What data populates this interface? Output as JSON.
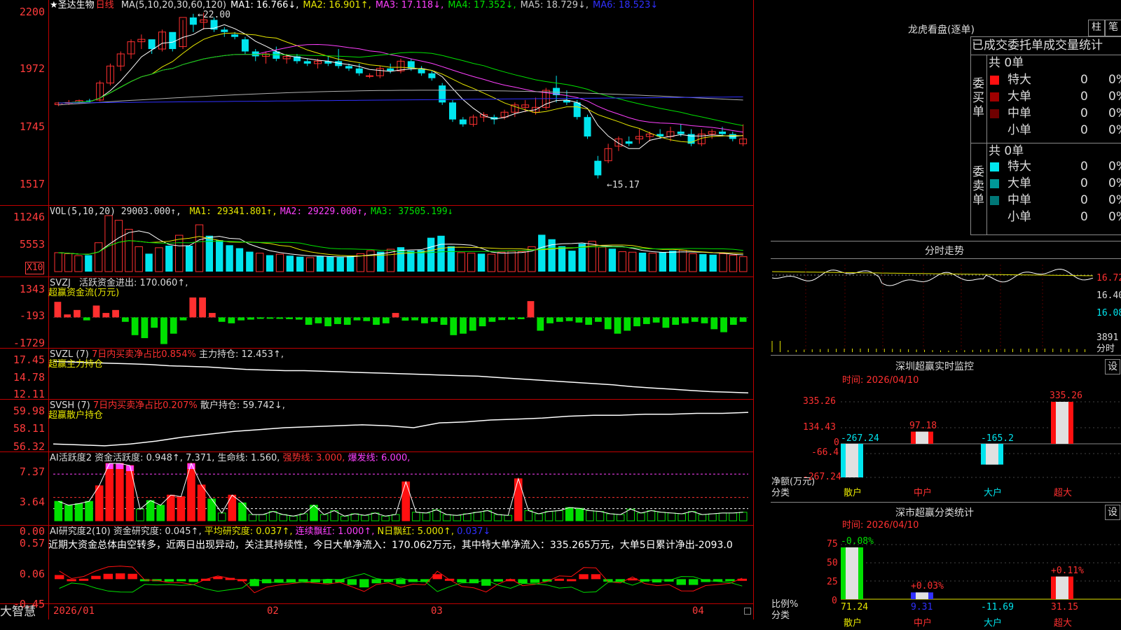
{
  "stock": {
    "name": "圣达生物",
    "period": "日线",
    "star": "★"
  },
  "colors": {
    "up": "#ff3030",
    "down": "#00e5ee",
    "ma1": "#ffffff",
    "ma2": "#e6e600",
    "ma3": "#ff40ff",
    "ma4": "#00e000",
    "ma5": "#b0b0b0",
    "ma6": "#3030ff",
    "grid": "#c00000",
    "axis": "#ff3b3b"
  },
  "main": {
    "legend": [
      {
        "text": "MA(5,10,20,30,60,120)",
        "color": "#dddddd"
      },
      {
        "text": "MA1: 16.766↓,",
        "color": "#ffffff"
      },
      {
        "text": "MA2: 16.901↑,",
        "color": "#e6e600"
      },
      {
        "text": "MA3: 17.118↓,",
        "color": "#ff40ff"
      },
      {
        "text": "MA4: 17.352↓,",
        "color": "#00e000"
      },
      {
        "text": "MA5: 18.729↓,",
        "color": "#c8c8c8"
      },
      {
        "text": "MA6: 18.523↓",
        "color": "#3030ff"
      }
    ],
    "yticks": [
      "2200",
      "1972",
      "1745",
      "1517"
    ],
    "high_label": "←22.00",
    "low_label": "←15.17"
  },
  "volume": {
    "title": "VOL(5,10,20)",
    "value": "29003.000↑,",
    "ma": [
      {
        "text": "MA1: 29341.801↑,",
        "color": "#e6e600"
      },
      {
        "text": "MA2: 29229.000↑,",
        "color": "#ff40ff"
      },
      {
        "text": "MA3: 37505.199↓",
        "color": "#00e000"
      }
    ],
    "yticks": [
      "11246",
      "5553"
    ],
    "unit": "X10"
  },
  "svzj": {
    "title": "SVZJ",
    "label": "活跃资金进出: 170.060↑,",
    "sub": "超赢资金流(万元)",
    "yticks": [
      "1343",
      "-193",
      "-1729"
    ]
  },
  "svzl": {
    "title": "SVZL (7)",
    "label1": "7日内买卖净占比0.854%",
    "label2": "主力持仓: 12.453↑,",
    "sub": "超赢主力持仓",
    "yticks": [
      "17.45",
      "14.78",
      "12.11"
    ]
  },
  "svsh": {
    "title": "SVSH (7)",
    "label1": "7日内买卖净占比0.207%",
    "label2": "散户持仓: 59.742↓,",
    "sub": "超赢散户持仓",
    "yticks": [
      "59.98",
      "58.11",
      "56.32"
    ]
  },
  "ai1": {
    "title": "AI活跃度2",
    "a": "资金活跃度: 0.948↑,",
    "b": "7.371,",
    "c": "生命线: 1.560,",
    "d": "强势线: 3.000,",
    "e": "爆发线: 6.000,",
    "yticks": [
      "7.37",
      "3.64",
      "0.00"
    ]
  },
  "ai2": {
    "title": "AI研究度2(10)",
    "a": "资金研究度: 0.045↑,",
    "b": "平均研究度: 0.037↑,",
    "c": "连续飘红: 1.000↑,",
    "d": "N日飘红: 5.000↑,",
    "e": "0.037↓",
    "comment": "近期大资金总体由空转多，近两日出现异动，关注其持续性，今日大单净流入：170.062万元，其中特大单净流入：335.265万元，大单5日累计净出-2093.0",
    "yticks": [
      "0.57",
      "0.06",
      "-0.45"
    ]
  },
  "dates": [
    "2026/01",
    "02",
    "03",
    "04"
  ],
  "brand": "大智慧",
  "sidebar": {
    "title": "龙虎看盘(逐单)",
    "btn_bar": "柱",
    "btn_tick": "笔",
    "header": "已成交委托单成交量统计",
    "buy": {
      "side": "委买单",
      "total": "共 0单",
      "rows": [
        {
          "label": "特大",
          "v": "0",
          "p": "0%"
        },
        {
          "label": "大单",
          "v": "0",
          "p": "0%"
        },
        {
          "label": "中单",
          "v": "0",
          "p": "0%"
        },
        {
          "label": "小单",
          "v": "0",
          "p": "0%"
        }
      ]
    },
    "sell": {
      "side": "委卖单",
      "total": "共 0单",
      "rows": [
        {
          "label": "特大",
          "v": "0",
          "p": "0%"
        },
        {
          "label": "大单",
          "v": "0",
          "p": "0%"
        },
        {
          "label": "中单",
          "v": "0",
          "p": "0%"
        },
        {
          "label": "小单",
          "v": "0",
          "p": "0%"
        }
      ]
    },
    "intraday": {
      "title": "分时走势",
      "yticks": [
        "16.72",
        "16.40",
        "16.08"
      ],
      "vol": "3891",
      "vol_unit": "分时"
    },
    "sz_monitor": {
      "title": "深圳超赢实时监控",
      "btn": "设",
      "time": "时间: 2026/04/10",
      "yticks": [
        "335.26",
        "134.43",
        "0",
        "-66.4",
        "-267.24"
      ],
      "ylabel1": "净额(万元)",
      "ylabel2": "分类",
      "bars": [
        {
          "cat": "散户",
          "value": -267.24,
          "label": "-267.24"
        },
        {
          "cat": "中户",
          "value": 97.18,
          "label": "97.18"
        },
        {
          "cat": "大户",
          "value": -165.2,
          "label": "-165.2"
        },
        {
          "cat": "超大",
          "value": 335.26,
          "label": "335.26"
        }
      ]
    },
    "sz_class": {
      "title": "深市超赢分类统计",
      "btn": "设",
      "time": "时间: 2026/04/10",
      "yticks": [
        "75",
        "50",
        "25",
        "0"
      ],
      "ylabel1": "比例%",
      "ylabel2": "分类",
      "bars": [
        {
          "cat": "散户",
          "value": 71.24,
          "label": "71.24",
          "chg": "-0.08%"
        },
        {
          "cat": "中户",
          "value": 9.31,
          "label": "9.31",
          "chg": "+0.03%"
        },
        {
          "cat": "大户",
          "value": -11.69,
          "label": "-11.69",
          "chg": ""
        },
        {
          "cat": "超大",
          "value": 31.15,
          "label": "31.15",
          "chg": "+0.11%"
        }
      ]
    }
  },
  "chart_data": [
    {
      "type": "candlestick",
      "title": "圣达生物 日线",
      "ylim": [
        15.17,
        22.0
      ],
      "candles": [
        [
          18.21,
          18.32,
          18.15,
          18.28
        ],
        [
          18.28,
          18.4,
          18.2,
          18.3
        ],
        [
          18.3,
          18.42,
          18.25,
          18.38
        ],
        [
          18.38,
          18.45,
          18.3,
          18.35
        ],
        [
          18.4,
          19.2,
          18.35,
          19.1
        ],
        [
          19.1,
          19.9,
          19.0,
          19.8
        ],
        [
          19.8,
          20.4,
          19.6,
          20.3
        ],
        [
          20.3,
          20.9,
          20.1,
          20.8
        ],
        [
          20.8,
          21.1,
          20.5,
          20.9
        ],
        [
          20.9,
          20.7,
          20.3,
          20.5
        ],
        [
          20.5,
          21.3,
          20.4,
          21.2
        ],
        [
          21.2,
          20.7,
          20.4,
          20.5
        ],
        [
          20.6,
          21.7,
          20.5,
          21.8
        ],
        [
          21.8,
          21.95,
          21.2,
          21.5
        ],
        [
          21.6,
          22.0,
          21.3,
          21.7
        ],
        [
          21.7,
          21.8,
          21.2,
          21.3
        ],
        [
          21.3,
          21.4,
          21.0,
          21.2
        ],
        [
          21.1,
          21.2,
          20.9,
          21.0
        ],
        [
          20.9,
          21.0,
          20.3,
          20.4
        ],
        [
          20.4,
          20.5,
          20.0,
          20.2
        ],
        [
          20.2,
          20.4,
          19.9,
          20.3
        ],
        [
          20.4,
          20.6,
          20.0,
          20.1
        ],
        [
          20.1,
          20.3,
          19.9,
          20.2
        ],
        [
          20.2,
          20.3,
          19.9,
          20.0
        ],
        [
          20.0,
          20.1,
          19.8,
          19.9
        ],
        [
          19.9,
          20.1,
          19.7,
          20.0
        ],
        [
          20.0,
          20.2,
          19.8,
          19.9
        ],
        [
          20.0,
          20.5,
          19.7,
          19.8
        ],
        [
          19.8,
          19.9,
          19.6,
          19.7
        ],
        [
          19.7,
          19.9,
          19.4,
          19.5
        ],
        [
          19.4,
          19.5,
          19.3,
          19.4
        ],
        [
          19.4,
          19.8,
          19.3,
          19.7
        ],
        [
          19.7,
          19.9,
          19.5,
          19.6
        ],
        [
          19.6,
          20.1,
          19.5,
          20.0
        ],
        [
          20.0,
          20.1,
          19.6,
          19.7
        ],
        [
          19.7,
          19.8,
          19.4,
          19.5
        ],
        [
          19.5,
          19.6,
          19.2,
          19.3
        ],
        [
          19.0,
          19.1,
          18.2,
          18.3
        ],
        [
          18.3,
          18.4,
          17.5,
          17.6
        ],
        [
          17.6,
          17.7,
          17.3,
          17.4
        ],
        [
          17.4,
          17.8,
          17.3,
          17.7
        ],
        [
          17.7,
          17.9,
          17.5,
          17.8
        ],
        [
          17.7,
          17.8,
          17.4,
          17.6
        ],
        [
          17.7,
          18.0,
          17.6,
          17.9
        ],
        [
          17.9,
          18.3,
          17.7,
          18.2
        ],
        [
          18.1,
          18.4,
          17.9,
          18.2
        ],
        [
          17.9,
          18.5,
          17.8,
          18.1
        ],
        [
          18.1,
          18.9,
          18.0,
          18.8
        ],
        [
          18.9,
          19.4,
          18.3,
          18.6
        ],
        [
          18.4,
          18.8,
          18.2,
          18.3
        ],
        [
          18.3,
          18.4,
          17.6,
          17.7
        ],
        [
          17.7,
          17.8,
          16.8,
          16.9
        ],
        [
          15.9,
          16.1,
          15.17,
          15.3
        ],
        [
          15.9,
          16.6,
          15.8,
          16.4
        ],
        [
          16.5,
          16.9,
          16.3,
          16.8
        ],
        [
          16.7,
          16.9,
          16.5,
          16.6
        ],
        [
          16.8,
          17.2,
          16.6,
          16.9
        ],
        [
          16.9,
          17.1,
          16.7,
          17.0
        ],
        [
          17.0,
          17.2,
          16.8,
          16.9
        ],
        [
          16.9,
          17.3,
          16.7,
          17.1
        ],
        [
          17.1,
          17.4,
          16.9,
          17.0
        ],
        [
          17.0,
          17.2,
          16.5,
          16.6
        ],
        [
          16.6,
          17.2,
          16.5,
          17.0
        ],
        [
          17.0,
          17.2,
          16.8,
          17.1
        ],
        [
          17.1,
          17.3,
          16.9,
          17.0
        ],
        [
          17.0,
          17.1,
          16.7,
          16.8
        ],
        [
          16.6,
          17.4,
          16.5,
          16.8
        ]
      ],
      "series": [
        {
          "name": "MA1",
          "value": 16.766
        },
        {
          "name": "MA2",
          "value": 16.901
        },
        {
          "name": "MA3",
          "value": 17.118
        },
        {
          "name": "MA4",
          "value": 17.352
        },
        {
          "name": "MA5",
          "value": 18.729
        },
        {
          "name": "MA6",
          "value": 18.523
        }
      ]
    },
    {
      "type": "bar",
      "title": "VOL(5,10,20)",
      "ylim": [
        0,
        11246
      ],
      "values": [
        3800,
        3600,
        3200,
        3300,
        5800,
        11246,
        10300,
        8500,
        5000,
        3600,
        4800,
        5200,
        7300,
        5200,
        9400,
        7200,
        6300,
        5300,
        4700,
        4000,
        3700,
        3300,
        3500,
        3200,
        3000,
        2800,
        3100,
        3000,
        2900,
        3100,
        3600,
        4200,
        4000,
        4500,
        4900,
        4200,
        4300,
        6800,
        7200,
        5100,
        3800,
        3700,
        3600,
        3500,
        3900,
        4100,
        4000,
        5000,
        7400,
        6500,
        5100,
        4200,
        5600,
        6100,
        4900,
        4600,
        4000,
        3900,
        3800,
        3700,
        3900,
        4200,
        4300,
        3600,
        3500,
        3400,
        3600,
        3300,
        3000
      ]
    },
    {
      "type": "bar",
      "title": "SVZJ",
      "ylim": [
        -1729,
        1343
      ],
      "values": [
        1050,
        200,
        500,
        -200,
        800,
        300,
        500,
        -300,
        -1200,
        -1400,
        -700,
        -1800,
        -1100,
        -200,
        1343,
        1343,
        300,
        -300,
        -400,
        -200,
        -150,
        -100,
        -50,
        -100,
        -120,
        -150,
        -500,
        -400,
        -600,
        -450,
        -500,
        -200,
        -250,
        -500,
        -400,
        300,
        -220,
        -200,
        -400,
        -300,
        -500,
        -1200,
        -1100,
        -900,
        -600,
        -300,
        -180,
        -150,
        -120,
        1100,
        -900,
        -400,
        -300,
        -250,
        -350,
        -500,
        -300,
        -800,
        -1100,
        -900,
        -600,
        -450,
        -350,
        -700,
        -500,
        -400,
        -300,
        -400,
        -800,
        -1000,
        -500,
        -300
      ]
    },
    {
      "type": "line",
      "title": "SVZL (7)",
      "ylim": [
        12.11,
        17.45
      ],
      "values": [
        17.3,
        17.2,
        17.1,
        17.0,
        16.9,
        16.8,
        16.6,
        16.5,
        16.4,
        16.2,
        16.0,
        15.9,
        15.8,
        15.8,
        15.7,
        15.6,
        15.5,
        15.4,
        15.3,
        15.2,
        15.1,
        15.0,
        14.9,
        14.7,
        14.5,
        14.3,
        14.1,
        13.9,
        13.7,
        13.5,
        13.2,
        13.0,
        12.8,
        12.6,
        12.4,
        12.3,
        12.2
      ]
    },
    {
      "type": "line",
      "title": "SVSH (7)",
      "ylim": [
        56.32,
        59.98
      ],
      "values": [
        56.6,
        56.5,
        56.4,
        56.6,
        56.9,
        57.3,
        57.6,
        57.9,
        58.1,
        58.3,
        58.4,
        58.5,
        58.6,
        58.5,
        58.3,
        58.8,
        58.9,
        59.1,
        59.2,
        59.3,
        59.5,
        59.6,
        59.6,
        59.7,
        59.7,
        59.8,
        59.8,
        59.9
      ]
    },
    {
      "type": "bar",
      "title": "AI活跃度2",
      "ylim": [
        0,
        7.37
      ],
      "values": [
        2.5,
        2.0,
        2.2,
        2.5,
        4.5,
        7.37,
        7.37,
        7.1,
        1.5,
        2.6,
        2.0,
        3.3,
        3.1,
        7.37,
        4.6,
        2.8,
        1.0,
        3.3,
        2.3,
        0.8,
        0.8,
        1.2,
        0.8,
        0.6,
        0.9,
        2.0,
        0.8,
        1.3,
        0.6,
        0.9,
        0.7,
        1.0,
        0.6,
        0.8,
        5.0,
        1.1,
        1.0,
        1.4,
        0.8,
        0.7,
        0.9,
        1.1,
        1.3,
        0.8,
        0.7,
        5.4,
        1.3,
        0.9,
        1.2,
        1.3,
        1.7,
        1.6,
        1.3,
        1.2,
        0.9,
        0.8,
        1.5,
        1.0,
        1.3,
        1.1,
        1.0,
        0.9,
        1.2,
        0.8,
        0.9,
        1.0,
        1.0,
        1.1
      ]
    },
    {
      "type": "bar",
      "title": "AI研究度2(10)",
      "ylim": [
        -0.45,
        0.57
      ],
      "values": [
        0.12,
        0.01,
        0.03,
        0.1,
        0.15,
        0.16,
        0.15,
        -0.02,
        -0.02,
        -0.04,
        -0.03,
        -0.05,
        0.03,
        0.08,
        0.05,
        0.02,
        -0.15,
        -0.08,
        -0.06,
        -0.05,
        -0.04,
        -0.06,
        -0.08,
        -0.06,
        -0.12,
        -0.18,
        -0.08,
        -0.05,
        -0.1,
        -0.05,
        -0.05,
        0.14,
        0.03,
        -0.06,
        -0.08,
        -0.14,
        -0.04,
        0.02,
        -0.08,
        -0.07,
        -0.04,
        0.03,
        0.02,
        0.14,
        0.14,
        -0.04,
        -0.05,
        0.04,
        -0.04,
        -0.06,
        -0.04,
        -0.12,
        -0.12,
        -0.05,
        -0.04,
        -0.03,
        0.03
      ]
    }
  ]
}
